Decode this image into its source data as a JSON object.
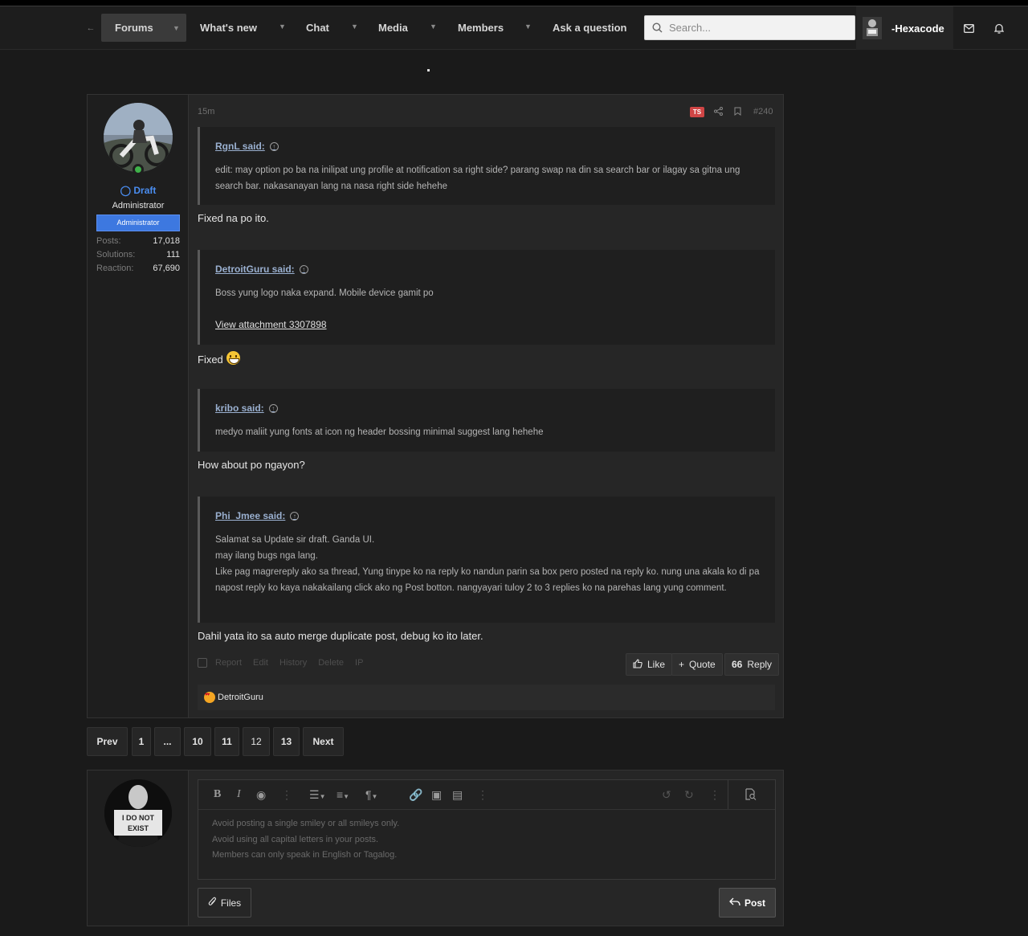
{
  "nav": {
    "items": [
      {
        "label": "Forums",
        "active": true
      },
      {
        "label": "What's new"
      },
      {
        "label": "Chat"
      },
      {
        "label": "Media"
      },
      {
        "label": "Members"
      },
      {
        "label": "Ask a question"
      }
    ],
    "search_placeholder": "Search...",
    "username": "-Hexacode",
    "icons": [
      "collapse-icon",
      "search-icon",
      "envelope-icon",
      "bell-icon"
    ]
  },
  "post": {
    "time": "15m",
    "ts_badge": "TS",
    "number": "#240",
    "author": {
      "name": "Draft",
      "title": "Administrator",
      "banner": "Administrator",
      "stats": [
        {
          "key": "Posts:",
          "value": "17,018"
        },
        {
          "key": "Solutions:",
          "value": "111"
        },
        {
          "key": "Reaction:",
          "value": "67,690"
        }
      ]
    },
    "quotes": [
      {
        "author": "RgnL said:",
        "body": "edit: may option po ba na inilipat ung profile at notification sa right side? parang swap na din sa search bar or ilagay sa gitna ung search bar. nakasanayan lang na nasa right side hehehe",
        "reply": "Fixed na po ito."
      },
      {
        "author": "DetroitGuru said:",
        "body": "Boss yung logo naka expand. Mobile device gamit po",
        "link": "View attachment 3307898",
        "reply": "Fixed"
      },
      {
        "author": "kribo said:",
        "body": "medyo maliit yung fonts at icon ng header bossing minimal suggest lang hehehe",
        "reply": "How about po ngayon?"
      },
      {
        "author": "Phi_Jmee said:",
        "lines": [
          "Salamat sa Update sir draft. Ganda UI.",
          "may ilang bugs nga lang.",
          "Like pag magrereply ako sa thread, Yung tinype ko na reply ko nandun parin sa box pero posted na reply ko. nung una akala ko di pa napost reply ko kaya nakakailang click ako ng Post botton. nangyayari tuloy 2 to 3 replies ko na parehas lang yung comment."
        ],
        "reply": "Dahil yata ito sa auto merge duplicate post, debug ko ito later."
      }
    ],
    "mod_actions": [
      "Report",
      "Edit",
      "History",
      "Delete",
      "IP"
    ],
    "buttons": {
      "like": "Like",
      "quote": "Quote",
      "reply": "Reply"
    },
    "reactions": {
      "user": "DetroitGuru"
    }
  },
  "pagination": [
    "Prev",
    "1",
    "...",
    "10",
    "11",
    "12",
    "13",
    "Next"
  ],
  "reply_box": {
    "avatar_text": [
      "I DO NOT",
      "EXIST"
    ],
    "hints": [
      "Avoid posting a single smiley or all smileys only.",
      "Avoid using all capital letters in your posts.",
      "Members can only speak in English or Tagalog."
    ],
    "files_label": "Files",
    "post_label": "Post"
  }
}
